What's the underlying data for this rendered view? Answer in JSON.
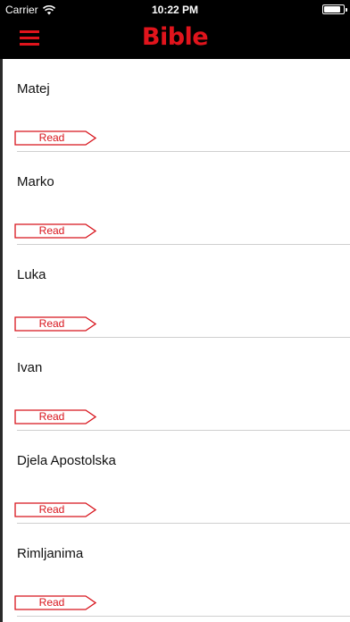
{
  "status_bar": {
    "carrier": "Carrier",
    "time": "10:22 PM",
    "battery_level": 0.85
  },
  "nav": {
    "title": "Bible",
    "menu_icon": "hamburger-menu-icon"
  },
  "colors": {
    "accent": "#e0141c",
    "background": "#000000",
    "list_background": "#ffffff"
  },
  "books": [
    {
      "name": "Matej",
      "action": "Read"
    },
    {
      "name": "Marko",
      "action": "Read"
    },
    {
      "name": "Luka",
      "action": "Read"
    },
    {
      "name": "Ivan",
      "action": "Read"
    },
    {
      "name": "Djela Apostolska",
      "action": "Read"
    },
    {
      "name": "Rimljanima",
      "action": "Read"
    }
  ]
}
